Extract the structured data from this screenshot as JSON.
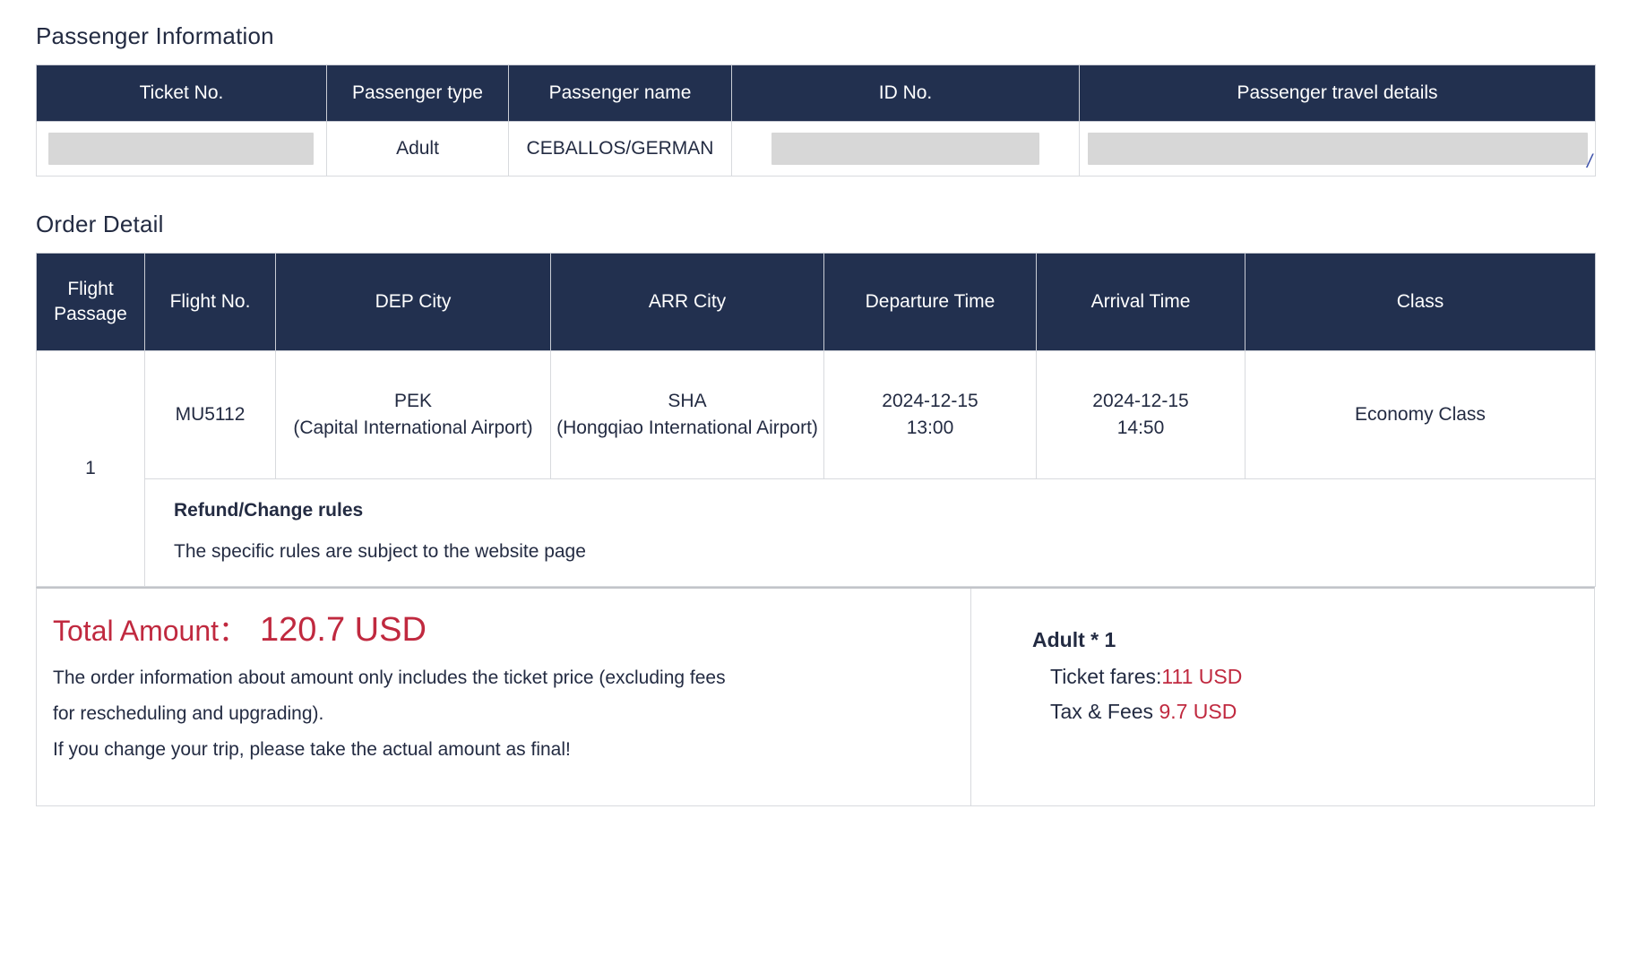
{
  "passenger_section": {
    "title": "Passenger Information",
    "columns": [
      "Ticket No.",
      "Passenger type",
      "Passenger name",
      "ID No.",
      "Passenger travel details"
    ],
    "row": {
      "ticket_no": "",
      "passenger_type": "Adult",
      "passenger_name": "CEBALLOS/GERMAN",
      "id_no": "",
      "travel_details": "",
      "travel_details_glyph": "/"
    }
  },
  "order_section": {
    "title": "Order Detail",
    "columns": {
      "flight_passage_line1": "Flight",
      "flight_passage_line2": "Passage",
      "flight_no": "Flight No.",
      "dep_city": "DEP City",
      "arr_city": "ARR City",
      "departure_time": "Departure Time",
      "arrival_time": "Arrival Time",
      "class": "Class"
    },
    "flight": {
      "passage": "1",
      "flight_no": "MU5112",
      "dep_code": "PEK",
      "dep_airport": "(Capital International Airport)",
      "arr_code": "SHA",
      "arr_airport": "(Hongqiao International Airport)",
      "departure_date": "2024-12-15",
      "departure_time": "13:00",
      "arrival_date": "2024-12-15",
      "arrival_time": "14:50",
      "class": "Economy Class"
    },
    "rules": {
      "title": "Refund/Change rules",
      "body": "The specific rules are subject to the website page"
    }
  },
  "summary": {
    "total_label": "Total Amount：",
    "total_value": "120.7 USD",
    "note_line_1": "The order information about amount only includes the ticket price (excluding fees",
    "note_line_2": "for rescheduling and upgrading).",
    "note_line_3": "If you change your trip, please take the actual amount as final!",
    "breakdown": {
      "pax_heading": "Adult * 1",
      "ticket_fares_label": "Ticket fares:",
      "ticket_fares_value": "111 USD",
      "tax_fees_label": "Tax & Fees ",
      "tax_fees_value": "9.7 USD"
    }
  },
  "colors": {
    "header_navy": "#22304f",
    "accent_red": "#c0293f",
    "text_dark": "#232b42",
    "redaction_gray": "#d7d7d7"
  }
}
